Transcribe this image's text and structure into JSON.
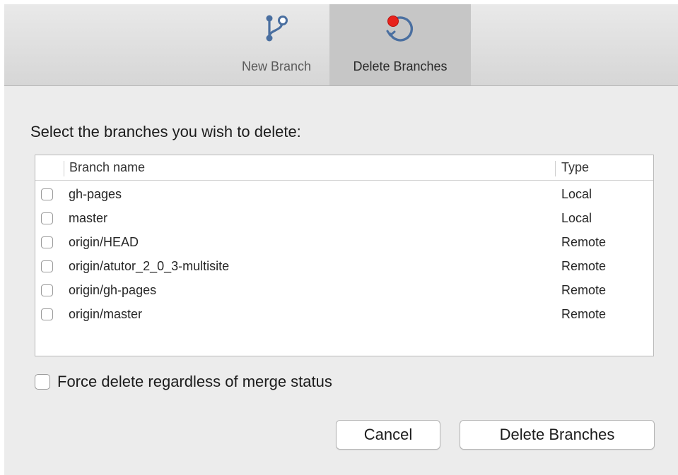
{
  "toolbar": {
    "new_branch_label": "New Branch",
    "delete_branches_label": "Delete Branches",
    "selected": "delete_branches"
  },
  "dialog": {
    "prompt": "Select the branches you wish to delete:",
    "columns": [
      "Branch name",
      "Type"
    ],
    "branches": [
      {
        "name": "gh-pages",
        "type": "Local",
        "checked": false
      },
      {
        "name": "master",
        "type": "Local",
        "checked": false
      },
      {
        "name": "origin/HEAD",
        "type": "Remote",
        "checked": false
      },
      {
        "name": "origin/atutor_2_0_3-multisite",
        "type": "Remote",
        "checked": false
      },
      {
        "name": "origin/gh-pages",
        "type": "Remote",
        "checked": false
      },
      {
        "name": "origin/master",
        "type": "Remote",
        "checked": false
      }
    ],
    "force_delete_label": "Force delete regardless of merge status",
    "force_delete_checked": false,
    "cancel_label": "Cancel",
    "confirm_label": "Delete Branches"
  },
  "icons": {
    "new_branch": "branch-icon",
    "delete_branches": "delete-branch-icon"
  },
  "colors": {
    "icon_blue": "#4a6fa0",
    "delete_dot_red": "#e8221c"
  }
}
